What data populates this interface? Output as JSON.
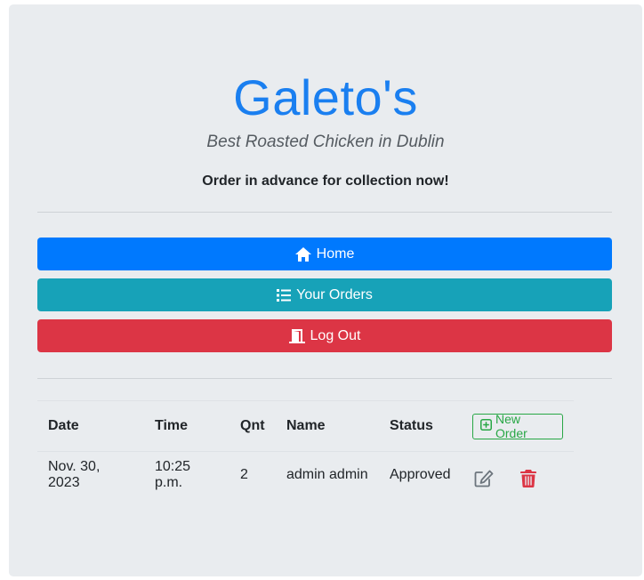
{
  "header": {
    "title": "Galeto's",
    "tagline": "Best Roasted Chicken in Dublin",
    "intro": "Order in advance for collection now!"
  },
  "nav": {
    "home": {
      "label": "Home",
      "icon": "home-icon",
      "color": "#0079fe"
    },
    "orders": {
      "label": "Your Orders",
      "icon": "list-icon",
      "color": "#17a2b8"
    },
    "logout": {
      "label": "Log Out",
      "icon": "door-open-icon",
      "color": "#dc3545"
    }
  },
  "table": {
    "columns": [
      "Date",
      "Time",
      "Qnt",
      "Name",
      "Status"
    ],
    "new_order_label": "New Order",
    "rows": [
      {
        "date": "Nov. 30, 2023",
        "time": "10:25 p.m.",
        "qnt": "2",
        "name": "admin admin",
        "status": "Approved"
      }
    ]
  },
  "colors": {
    "accent": "#1a7ff0",
    "success": "#28a745",
    "danger": "#dc3545"
  }
}
